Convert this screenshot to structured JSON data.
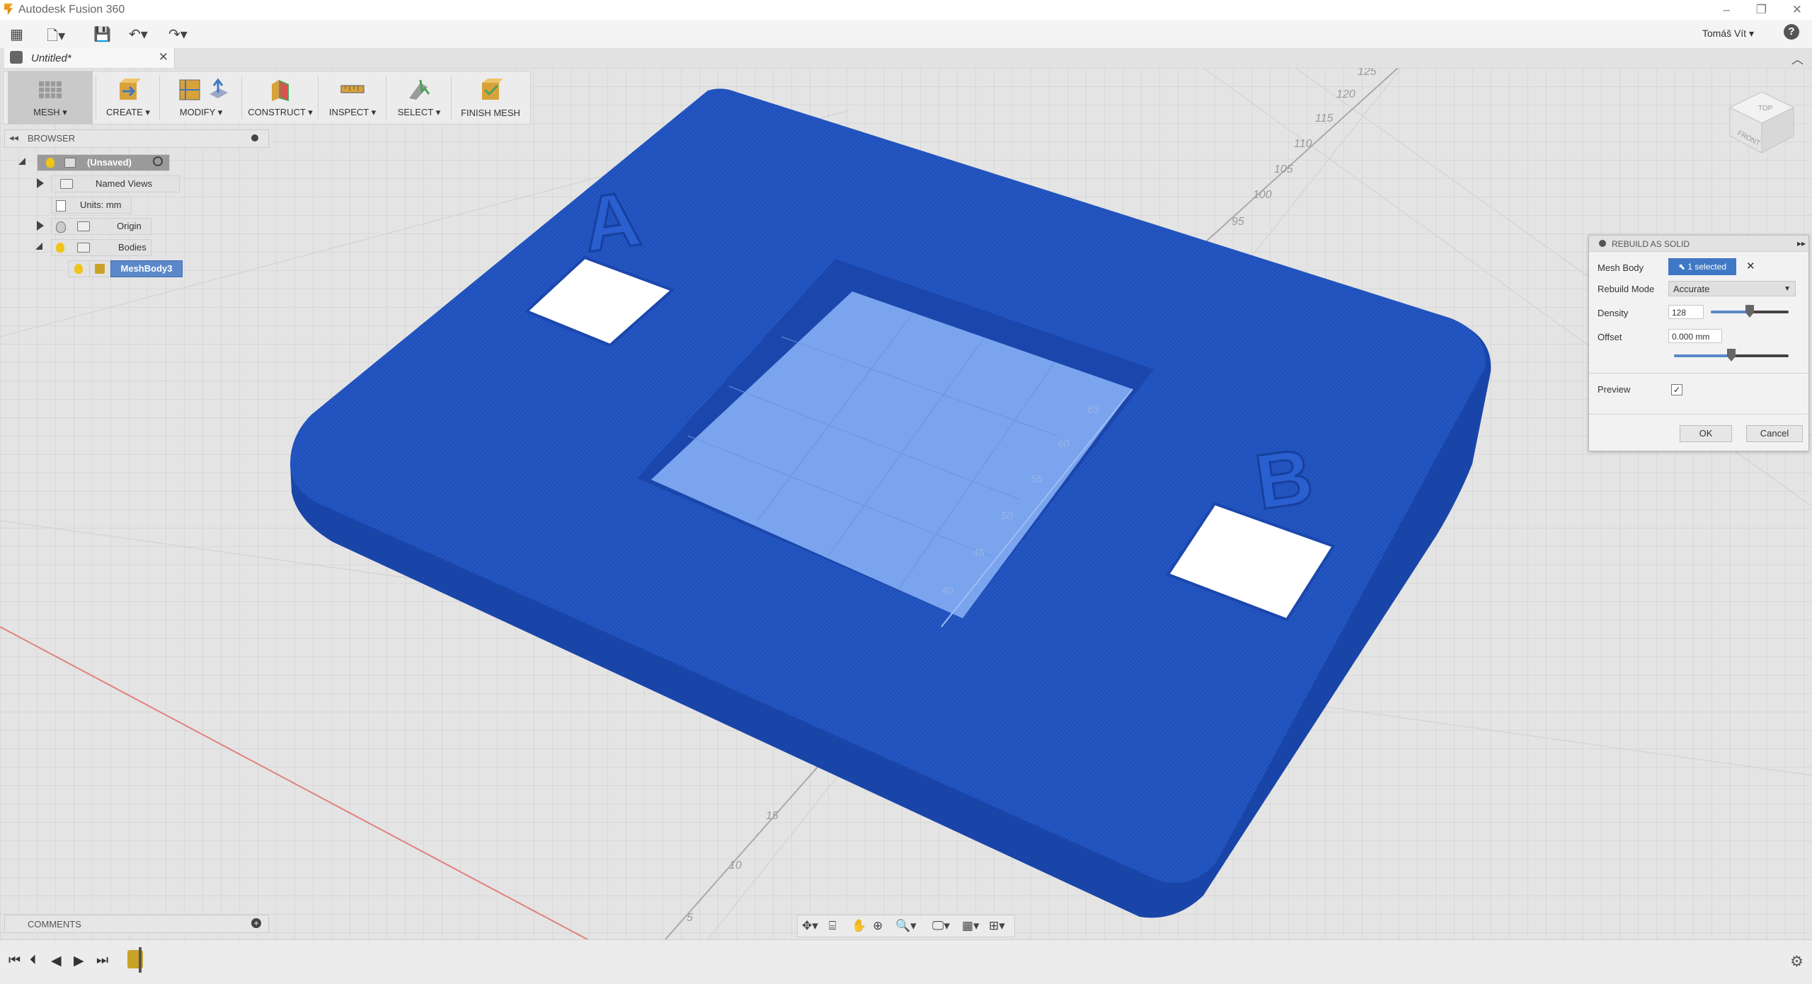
{
  "app": {
    "title": "Autodesk Fusion 360"
  },
  "window": {
    "minimize": "–",
    "restore": "❐",
    "close": "✕"
  },
  "quick_access": {
    "user": "Tomáš Vít ▾",
    "help": "?"
  },
  "document": {
    "tab_title": "Untitled*",
    "close": "✕"
  },
  "toolbar": {
    "mesh": "MESH ▾",
    "create": "CREATE ▾",
    "modify": "MODIFY ▾",
    "construct": "CONSTRUCT ▾",
    "inspect": "INSPECT ▾",
    "select": "SELECT ▾",
    "finish": "FINISH MESH"
  },
  "browser": {
    "title": "BROWSER",
    "root": "(Unsaved)",
    "named_views": "Named Views",
    "units": "Units: mm",
    "origin": "Origin",
    "bodies": "Bodies",
    "body": "MeshBody3"
  },
  "comments": {
    "title": "COMMENTS"
  },
  "viewcube": {
    "top": "TOP",
    "front": "FRONT"
  },
  "model": {
    "letter_a": "A",
    "letter_b": "B"
  },
  "ruler": {
    "back_ticks": [
      "125",
      "120",
      "115",
      "110",
      "105",
      "100",
      "95"
    ],
    "inner_ticks": [
      "65",
      "60",
      "55",
      "50",
      "45",
      "40"
    ],
    "front_ticks": [
      "15",
      "10",
      "5"
    ]
  },
  "dialog": {
    "title": "REBUILD AS SOLID",
    "mesh_body_label": "Mesh Body",
    "mesh_body_value": "1 selected",
    "rebuild_mode_label": "Rebuild Mode",
    "rebuild_mode_value": "Accurate",
    "density_label": "Density",
    "density_value": "128",
    "offset_label": "Offset",
    "offset_value": "0.000 mm",
    "preview_label": "Preview",
    "preview_checked": true,
    "ok": "OK",
    "cancel": "Cancel",
    "density_level": 0.5,
    "offset_level": 0.5
  },
  "colors": {
    "mesh_blue": "#2255c4",
    "accent": "#3f78c4"
  }
}
